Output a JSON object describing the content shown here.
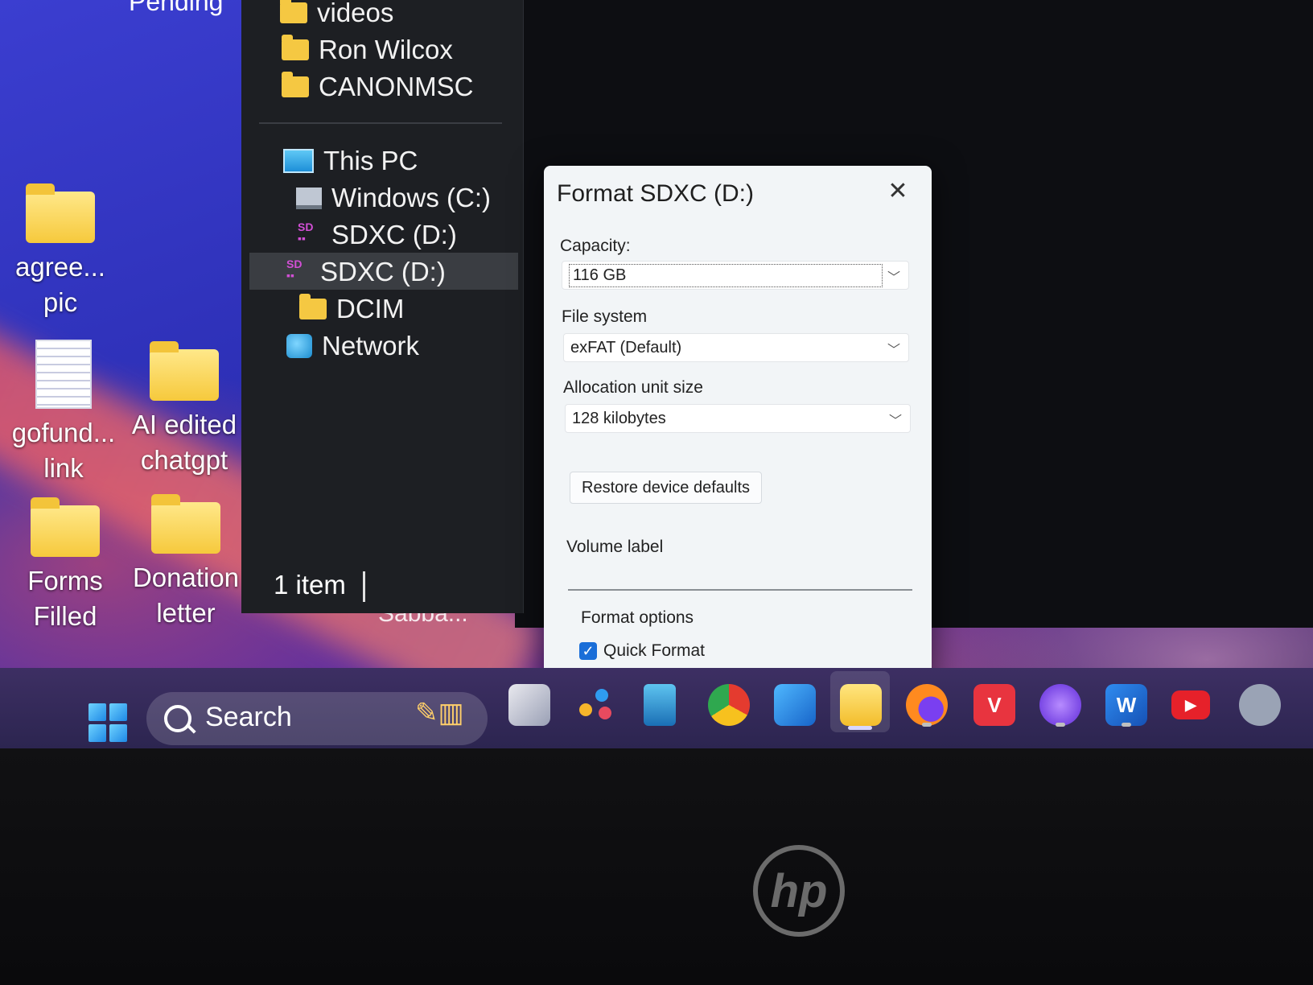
{
  "desktop": {
    "top_label": "Pending",
    "icons": [
      {
        "line1": "agree...",
        "line2": "pic"
      },
      {
        "line1": "gofund...",
        "line2": "link"
      },
      {
        "line1": "AI edited",
        "line2": "chatgpt"
      },
      {
        "line1": "Forms",
        "line2": "Filled"
      },
      {
        "line1": "Donation",
        "line2": "letter"
      }
    ],
    "partial_label": "Sabba..."
  },
  "explorer": {
    "nav_items": [
      {
        "label": "videos"
      },
      {
        "label": "Ron Wilcox"
      },
      {
        "label": "CANONMSC"
      },
      {
        "label": "This PC"
      },
      {
        "label": "Windows (C:)"
      },
      {
        "label": "SDXC (D:)"
      },
      {
        "label": "SDXC (D:)"
      },
      {
        "label": "DCIM"
      },
      {
        "label": "Network"
      }
    ],
    "status": "1 item"
  },
  "dialog": {
    "title": "Format SDXC (D:)",
    "close_glyph": "✕",
    "capacity_label": "Capacity:",
    "capacity_value": "116 GB",
    "filesystem_label": "File system",
    "filesystem_value": "exFAT (Default)",
    "allocation_label": "Allocation unit size",
    "allocation_value": "128 kilobytes",
    "restore_button": "Restore device defaults",
    "volume_label": "Volume label",
    "volume_value": "",
    "options_label": "Format options",
    "quick_format_label": "Quick Format",
    "quick_format_checked": true,
    "chevron_glyph": "﹀"
  },
  "taskbar": {
    "search_placeholder": "Search",
    "apps": [
      "task-view",
      "widgets",
      "calculator",
      "chrome",
      "photos",
      "file-explorer",
      "firefox",
      "vivaldi",
      "app-purple",
      "word",
      "youtube",
      "settings"
    ]
  },
  "bezel": {
    "brand": "hp"
  }
}
